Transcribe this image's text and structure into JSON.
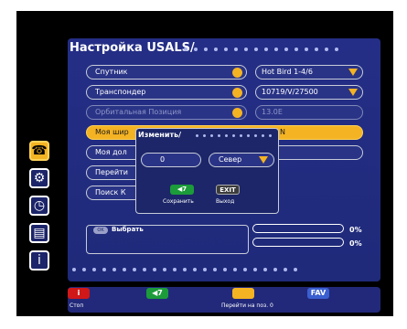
{
  "screen": {
    "title": "Настройка USALS/",
    "rows": [
      {
        "label": "Спутник",
        "value": "Hot Bird 1-4/6",
        "state": "normal",
        "has_dropdown": true
      },
      {
        "label": "Транспондер",
        "value": "10719/V/27500",
        "state": "normal",
        "has_dropdown": true
      },
      {
        "label": "Орбитальная Позиция",
        "value": "13.0E",
        "state": "disabled",
        "has_dropdown": false
      },
      {
        "label": "Моя шир",
        "value": "N",
        "state": "selected"
      },
      {
        "label": "Моя дол",
        "state": "normal"
      },
      {
        "label": "Перейти",
        "state": "normal"
      },
      {
        "label": "Поиск К",
        "state": "normal"
      }
    ]
  },
  "left_icons": [
    "satellite-dish-icon",
    "key-icon",
    "clock-icon",
    "level-meter-icon",
    "info-icon"
  ],
  "popup": {
    "title": "Изменить/",
    "input_value": "0",
    "direction": "Север",
    "save_key": "◀7",
    "save_label": "Сохранить",
    "exit_key": "EXIT",
    "exit_label": "Выход"
  },
  "signal": {
    "select_label": "Выбрать",
    "strength_pct": "0%",
    "quality_pct": "0%",
    "strength_level": 0,
    "quality_level": 0
  },
  "bottom_bar": {
    "red_key": "i",
    "red_label": "Стоп",
    "green_key": "◀7",
    "yellow_key": "",
    "yellow_label": "Перейти на поз. 0",
    "blue_key": "FAV"
  },
  "colors": {
    "panel": "#242e86",
    "accent": "#f4b323",
    "green": "#1c9b3a",
    "red": "#d01818",
    "blue": "#3a5fd0"
  }
}
